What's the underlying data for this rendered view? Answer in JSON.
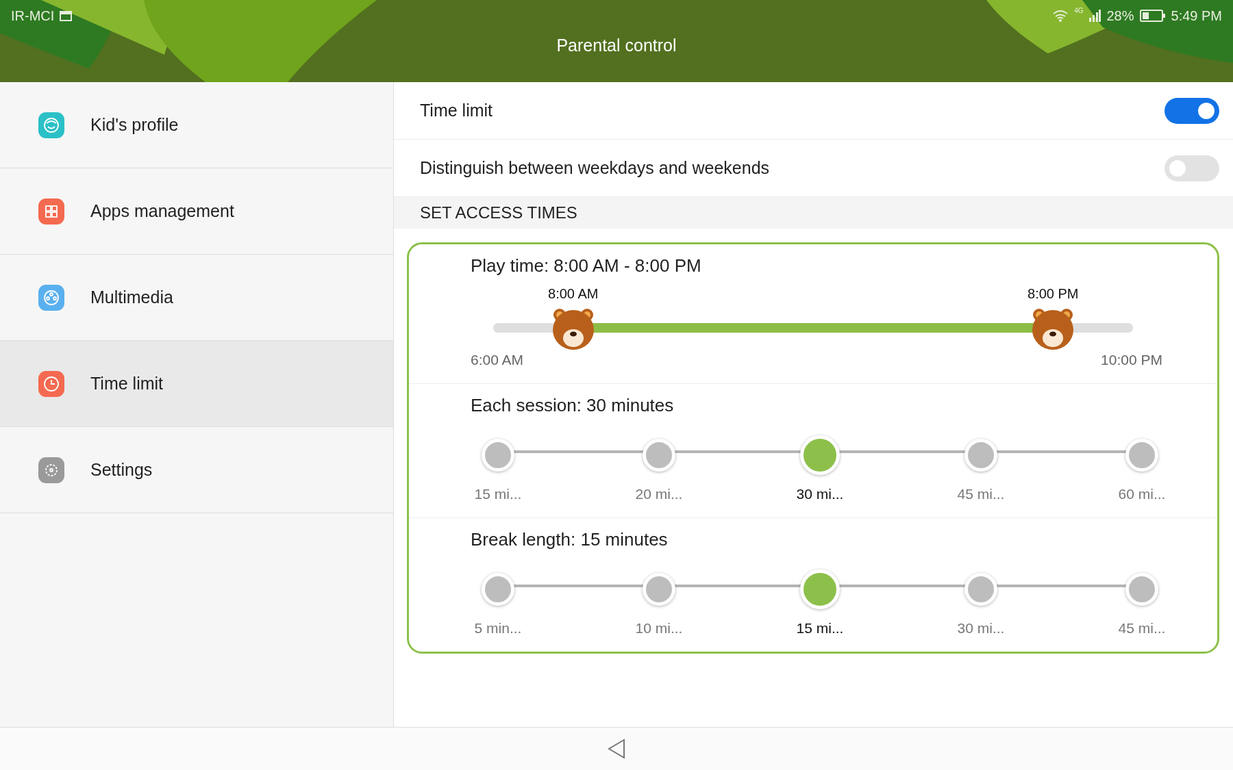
{
  "status_bar": {
    "carrier": "IR-MCI",
    "network": "4G",
    "battery": "28%",
    "time": "5:49 PM"
  },
  "header": {
    "title": "Parental control"
  },
  "sidebar": {
    "items": [
      {
        "label": "Kid's profile",
        "kind": "profile",
        "selected": false
      },
      {
        "label": "Apps management",
        "kind": "apps",
        "selected": false
      },
      {
        "label": "Multimedia",
        "kind": "media",
        "selected": false
      },
      {
        "label": "Time limit",
        "kind": "clock",
        "selected": true
      },
      {
        "label": "Settings",
        "kind": "settings",
        "selected": false
      }
    ]
  },
  "settings": [
    {
      "label": "Time limit",
      "on": true
    },
    {
      "label": "Distinguish between weekdays and weekends",
      "on": false
    }
  ],
  "section_header": "SET ACCESS TIMES",
  "play_time": {
    "title": "Play time: 8:00 AM - 8:00 PM",
    "min_label": "6:00 AM",
    "max_label": "10:00 PM",
    "thumbs": [
      {
        "label": "8:00 AM",
        "level": 0.125
      },
      {
        "label": "8:00 PM",
        "level": 0.875
      }
    ]
  },
  "step_sliders": [
    {
      "title": "Each session: 30 minutes",
      "options": [
        {
          "label": "15 mi...",
          "selected": false
        },
        {
          "label": "20 mi...",
          "selected": false
        },
        {
          "label": "30 mi...",
          "selected": true
        },
        {
          "label": "45 mi...",
          "selected": false
        },
        {
          "label": "60 mi...",
          "selected": false
        }
      ]
    },
    {
      "title": "Break length: 15 minutes",
      "options": [
        {
          "label": "5 min...",
          "selected": false
        },
        {
          "label": "10 mi...",
          "selected": false
        },
        {
          "label": "15 mi...",
          "selected": true
        },
        {
          "label": "30 mi...",
          "selected": false
        },
        {
          "label": "45 mi...",
          "selected": false
        }
      ]
    }
  ]
}
